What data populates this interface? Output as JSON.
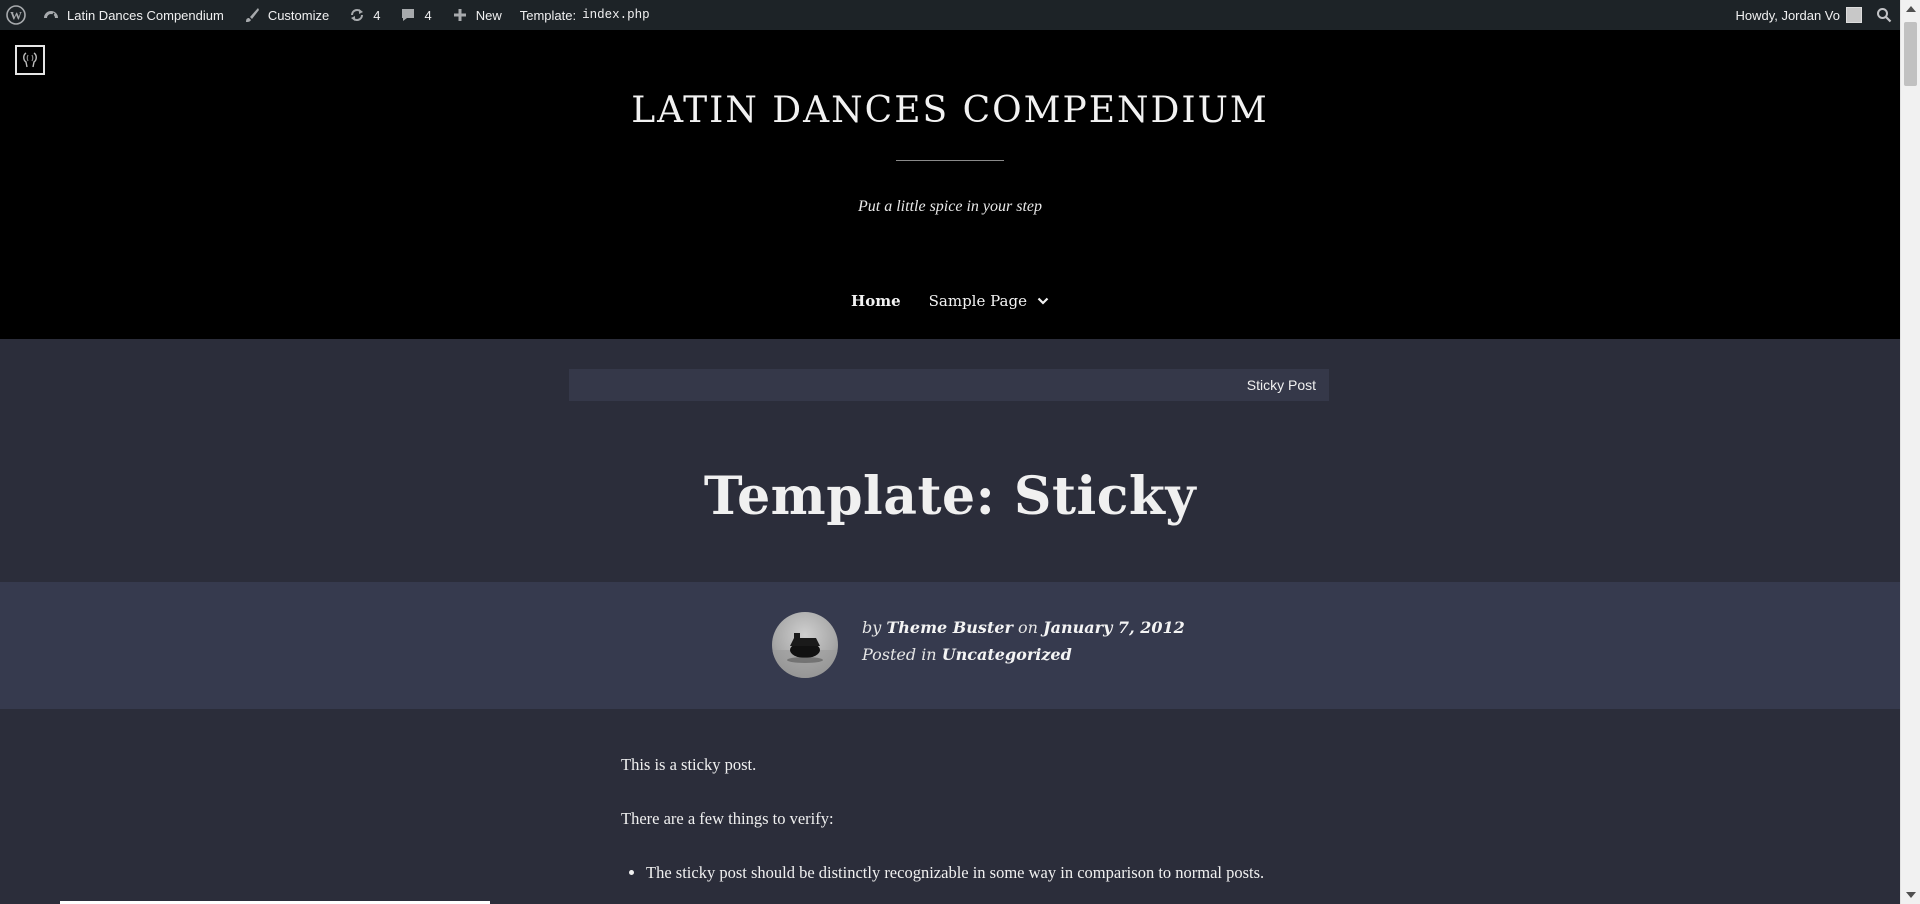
{
  "adminbar": {
    "site_name": "Latin Dances Compendium",
    "customize": "Customize",
    "updates_count": "4",
    "comments_count": "4",
    "new_label": "New",
    "template_label": "Template:",
    "template_file": "index.php",
    "howdy": "Howdy, Jordan Vo"
  },
  "header": {
    "site_title": "LATIN DANCES COMPENDIUM",
    "tagline": "Put a little spice in your step",
    "nav": {
      "home": "Home",
      "sample_page": "Sample Page"
    }
  },
  "breadcrumb": {
    "label": "Sticky Post"
  },
  "post": {
    "title": "Template: Sticky",
    "meta": {
      "by": "by",
      "author": "Theme Buster",
      "on": "on",
      "date": "January 7, 2012",
      "posted_in": "Posted in",
      "category": "Uncategorized"
    },
    "paragraphs": [
      "This is a sticky post.",
      "There are a few things to verify:"
    ],
    "list_items": [
      "The sticky post should be distinctly recognizable in some way in comparison to normal posts."
    ]
  },
  "colors": {
    "adminbar_bg": "#1d2327",
    "header_bg": "#000000",
    "page_bg": "#2b2d3a",
    "meta_band_bg": "#363a4e",
    "breadcrumb_bg": "#353849"
  }
}
